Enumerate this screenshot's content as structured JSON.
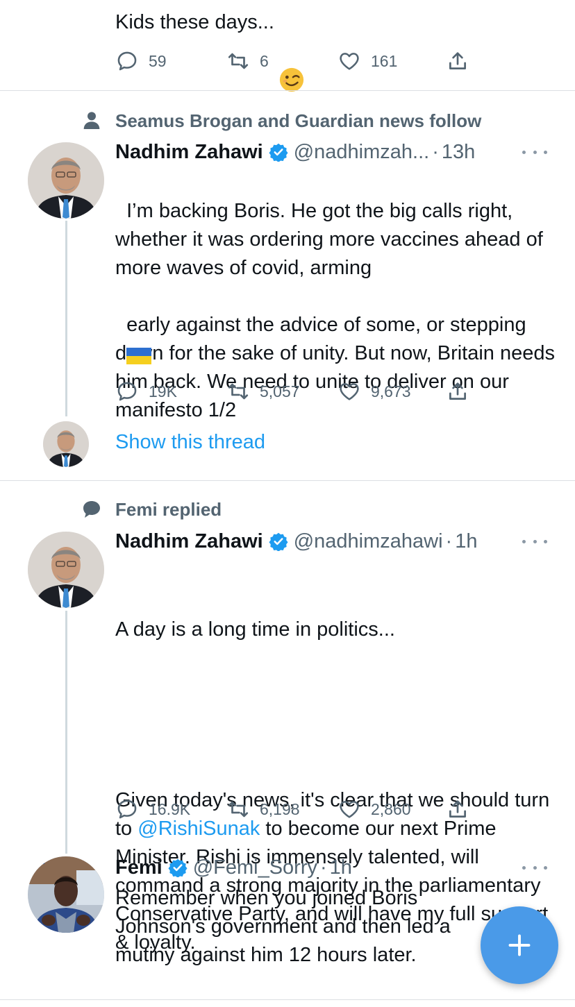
{
  "tweet0": {
    "partial_text": "Kids these days...",
    "emoji": "wink-emoji",
    "actions": {
      "replies": "59",
      "retweets": "6",
      "likes": "161"
    }
  },
  "tweet1": {
    "context": "Seamus Brogan and Guardian news follow",
    "context_icon": "person-icon",
    "author_name": "Nadhim Zahawi",
    "handle": "@nadhimzah...",
    "separator": "·",
    "time": "13h",
    "text_a": "I’m backing Boris. He got the big calls right, whether it was ordering more vaccines ahead of more waves of covid, arming",
    "flag": "ukraine-flag",
    "text_b": "early against the advice of some, or stepping down for the sake of unity. But now, Britain needs him back. We need to unite to deliver on our manifesto 1/2",
    "actions": {
      "replies": "19K",
      "retweets": "5,057",
      "likes": "9,673"
    },
    "show_thread": "Show this thread"
  },
  "tweet2": {
    "context": "Femi replied",
    "context_icon": "speech-bubble-icon",
    "author_name": "Nadhim Zahawi",
    "handle": "@nadhimzahawi",
    "separator": "·",
    "time": "1h",
    "text_1": "A day is a long time in politics...",
    "text_2a": "Given today's news, it's clear that we should turn to ",
    "mention": "@RishiSunak",
    "text_2b": " to become our next Prime Minister. Rishi is immensely talented, will command a strong majority in the parliamentary Conservative Party, and will have my full support & loyalty.",
    "actions": {
      "replies": "16.9K",
      "retweets": "6,198",
      "likes": "2,860"
    }
  },
  "tweet3": {
    "author_name": "Femi",
    "handle": "@Femi_Sorry",
    "separator": "·",
    "time": "1h",
    "text": "Remember when you joined Boris Johnson's government and then led a mutiny against him 12 hours later."
  },
  "colors": {
    "accent": "#1d9bf0",
    "secondary_text": "#536471",
    "fab": "#4a9ae8"
  }
}
